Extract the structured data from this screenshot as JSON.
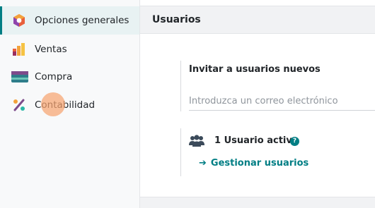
{
  "sidebar": {
    "items": [
      {
        "label": "Opciones generales",
        "icon": "settings-app-icon"
      },
      {
        "label": "Ventas",
        "icon": "sales-app-icon"
      },
      {
        "label": "Compra",
        "icon": "purchase-app-icon"
      },
      {
        "label": "Contabilidad",
        "icon": "accounting-app-icon"
      }
    ]
  },
  "main": {
    "section_title": "Usuarios",
    "invite": {
      "title": "Invitar a usuarios nuevos",
      "placeholder": "Introduzca un correo electrónico"
    },
    "users": {
      "active_label": "1 Usuario activo",
      "help_glyph": "?",
      "manage_arrow": "➔",
      "manage_label": "Gestionar usuarios"
    }
  },
  "colors": {
    "accent": "#017e84",
    "active_item_bg": "#e8f2f3",
    "click_marker": "#f7a370"
  }
}
